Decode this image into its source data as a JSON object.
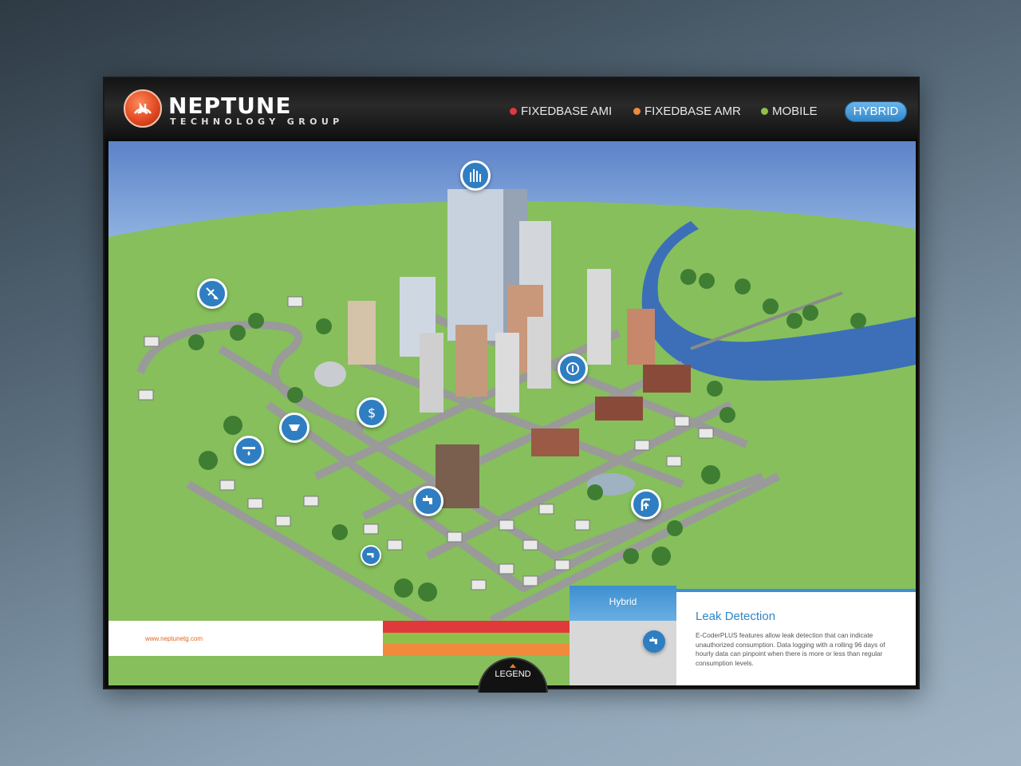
{
  "brand": {
    "name": "NEPTUNE",
    "tagline": "TECHNOLOGY GROUP",
    "color": "#e24a23"
  },
  "nav": {
    "items": [
      {
        "label": "FIXEDBASE AMI",
        "dot_color": "#e0393c"
      },
      {
        "label": "FIXEDBASE AMR",
        "dot_color": "#f08a3c"
      },
      {
        "label": "MOBILE",
        "dot_color": "#8fc04a"
      }
    ],
    "active": {
      "label": "HYBRID",
      "color": "#2f86c8"
    }
  },
  "map": {
    "hotspots": [
      {
        "name": "meter-reading-tower-icon"
      },
      {
        "name": "radio-signal-icon"
      },
      {
        "name": "billing-dollar-icon"
      },
      {
        "name": "info-shield-icon"
      },
      {
        "name": "water-tank-icon"
      },
      {
        "name": "leak-drop-icon"
      },
      {
        "name": "faucet-icon"
      },
      {
        "name": "faucet-small-icon"
      },
      {
        "name": "pipe-upload-icon"
      }
    ]
  },
  "footer": {
    "url": "www.neptunetg.com",
    "legend_colors": [
      "#e0393c",
      "#8fc04a",
      "#f08a3c"
    ],
    "legend_label": "LEGEND"
  },
  "info_panel": {
    "mode_label": "Hybrid",
    "icon": "faucet-icon",
    "title": "Leak Detection",
    "body": "E-CoderPLUS features allow leak detection that can indicate unauthorized consumption. Data logging with a rolling 96 days of hourly data can pinpoint when there is more or less than regular consumption levels."
  }
}
